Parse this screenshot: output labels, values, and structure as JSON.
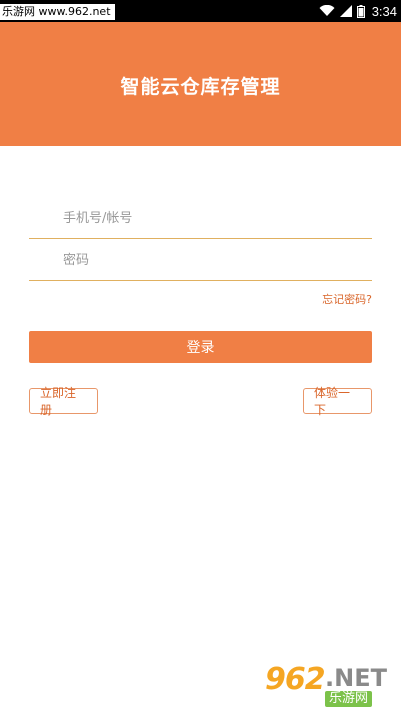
{
  "status_bar": {
    "site_tag": "乐游网 www.962.net",
    "time": "3:34",
    "icons": [
      "wifi-icon",
      "signal-icon",
      "battery-icon"
    ]
  },
  "header": {
    "title": "智能云仓库存管理",
    "background_color": "#F07F45"
  },
  "form": {
    "account_placeholder": "手机号/帐号",
    "password_placeholder": "密码",
    "forgot_password": "忘记密码?",
    "login_label": "登录",
    "register_label": "立即注册",
    "trial_label": "体验一下"
  },
  "watermark": {
    "number": "962",
    "net": ".NET",
    "name": "乐游网"
  },
  "colors": {
    "accent": "#F07F45",
    "underline": "#E0B060",
    "link": "#D9652A"
  }
}
